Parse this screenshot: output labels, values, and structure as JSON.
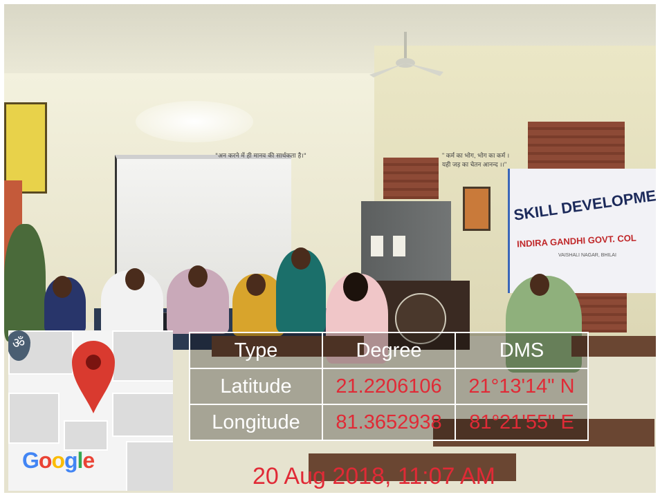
{
  "scene": {
    "description_tags": [
      "classroom",
      "projector-screen",
      "banner",
      "podium"
    ],
    "banner": {
      "line1": "SKILL DEVELOPMENT O",
      "line2": "INDIRA GANDHI GOVT. COL",
      "line3": "VAISHALI NAGAR, BHILAI"
    },
    "wall_quote_left": "\"अन करने में ही मानव की सार्थकता है।\"",
    "wall_quote_right": "\" कर्म का भोग, भोग का कर्म । यही जड़ का चेतन आनन्द ।।\""
  },
  "map": {
    "badge_icon": "om-icon",
    "badge_glyph": "ॐ",
    "pin_icon": "location-pin-icon",
    "logo": {
      "letters": [
        "G",
        "o",
        "o",
        "g",
        "l",
        "e"
      ]
    }
  },
  "gps": {
    "headers": [
      "Type",
      "Degree",
      "DMS"
    ],
    "rows": [
      {
        "type": "Latitude",
        "degree": "21.2206106",
        "dms": "21°13'14\" N"
      },
      {
        "type": "Longitude",
        "degree": "81.3652938",
        "dms": "81°21'55\" E"
      }
    ]
  },
  "timestamp": "20 Aug 2018, 11:07 AM",
  "colors": {
    "value_red": "#e02a36",
    "banner_blue": "#1c2a5a",
    "banner_red": "#c0282a",
    "pin_red": "#d93a2f"
  }
}
